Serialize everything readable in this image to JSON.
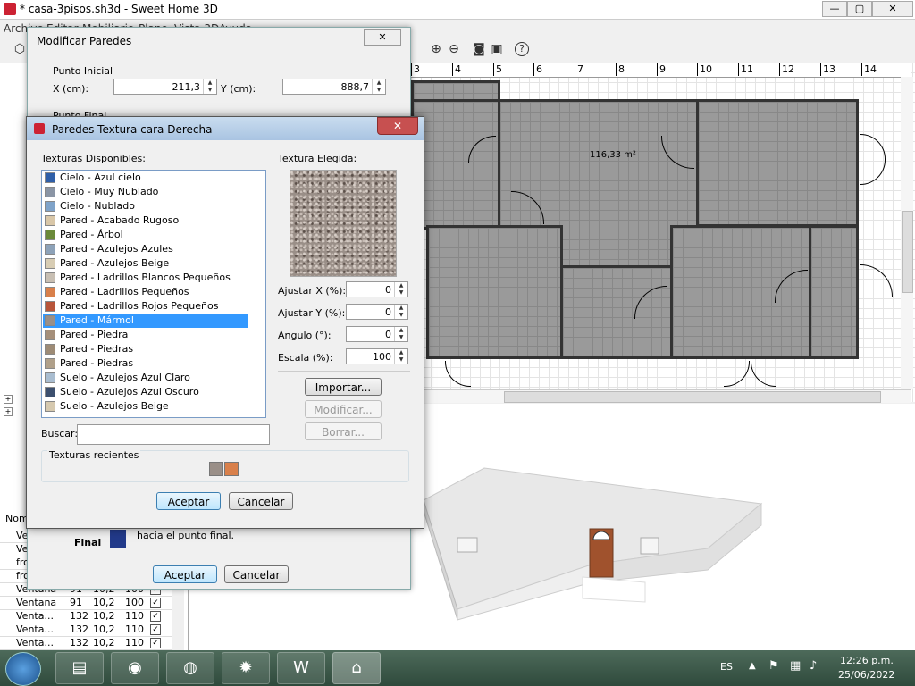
{
  "window": {
    "title": "* casa-3pisos.sh3d - Sweet Home 3D",
    "minimize": "—",
    "maximize": "▢",
    "close": "✕"
  },
  "menubar": [
    "Archivo",
    "Editar",
    "Mobiliario",
    "Plano",
    "Vista 3D",
    "Ayuda"
  ],
  "toolbar_icons": [
    "zoom-in-icon",
    "zoom-out-icon",
    "camera-icon",
    "video-icon",
    "help-icon"
  ],
  "plan": {
    "ruler": [
      "3",
      "4",
      "5",
      "6",
      "7",
      "8",
      "9",
      "10",
      "11",
      "12",
      "13",
      "14"
    ],
    "room_area": "116,33 m²"
  },
  "furniture_table": {
    "header": "Nom",
    "rows": [
      {
        "name": "Ven",
        "w": "",
        "d": "",
        "h": "",
        "visible": true
      },
      {
        "name": "Ven",
        "w": "",
        "d": "",
        "h": "",
        "visible": true
      },
      {
        "name": "fro",
        "w": "",
        "d": "",
        "h": "",
        "visible": true
      },
      {
        "name": "fro",
        "w": "",
        "d": "",
        "h": "",
        "visible": true
      },
      {
        "name": "Ventana",
        "w": "91",
        "d": "10,2",
        "h": "100",
        "visible": true
      },
      {
        "name": "Ventana",
        "w": "91",
        "d": "10,2",
        "h": "100",
        "visible": true
      },
      {
        "name": "Venta...",
        "w": "132",
        "d": "10,2",
        "h": "110",
        "visible": true
      },
      {
        "name": "Venta...",
        "w": "132",
        "d": "10,2",
        "h": "110",
        "visible": true
      },
      {
        "name": "Venta...",
        "w": "132",
        "d": "10,2",
        "h": "110",
        "visible": true
      }
    ]
  },
  "walls_dialog": {
    "title": "Modificar Paredes",
    "start_group": "Punto Inicial",
    "x_label": "X (cm):",
    "x_value": "211,3",
    "y_label": "Y (cm):",
    "y_value": "888,7",
    "end_group": "Punto Final",
    "final_label": "Final",
    "hint": "hacia el punto final.",
    "ok": "Aceptar",
    "cancel": "Cancelar"
  },
  "texture_dialog": {
    "title": "Paredes Textura cara Derecha",
    "available_label": "Texturas Disponibles:",
    "chosen_label": "Textura Elegida:",
    "textures": [
      {
        "name": "Cielo - Azul cielo",
        "color": "#2f5fa8"
      },
      {
        "name": "Cielo - Muy Nublado",
        "color": "#8a95a5"
      },
      {
        "name": "Cielo - Nublado",
        "color": "#7fa3c9"
      },
      {
        "name": "Pared - Acabado Rugoso",
        "color": "#d9c7a8"
      },
      {
        "name": "Pared - Árbol",
        "color": "#6b8a3a"
      },
      {
        "name": "Pared - Azulejos Azules",
        "color": "#8da2b8"
      },
      {
        "name": "Pared - Azulejos Beige",
        "color": "#d8cdb4"
      },
      {
        "name": "Pared - Ladrillos Blancos Pequeños",
        "color": "#c8bfb3"
      },
      {
        "name": "Pared - Ladrillos Pequeños",
        "color": "#d9804b"
      },
      {
        "name": "Pared - Ladrillos Rojos Pequeños",
        "color": "#b8553a"
      },
      {
        "name": "Pared - Mármol",
        "color": "#9a8f88"
      },
      {
        "name": "Pared - Piedra",
        "color": "#a58f7a"
      },
      {
        "name": "Pared - Piedras",
        "color": "#9d8b76"
      },
      {
        "name": "Pared - Piedras",
        "color": "#b0a08a"
      },
      {
        "name": "Suelo - Azulejos Azul Claro",
        "color": "#a9bdd0"
      },
      {
        "name": "Suelo - Azulejos Azul Oscuro",
        "color": "#3c4f6e"
      },
      {
        "name": "Suelo - Azulejos Beige",
        "color": "#d6c9af"
      }
    ],
    "selected": "Pared - Mármol",
    "adjust_x_label": "Ajustar X (%):",
    "adjust_x": "0",
    "adjust_y_label": "Ajustar Y (%):",
    "adjust_y": "0",
    "angle_label": "Ángulo (°):",
    "angle": "0",
    "scale_label": "Escala (%):",
    "scale": "100",
    "import": "Importar...",
    "modify": "Modificar...",
    "delete": "Borrar...",
    "search_label": "Buscar:",
    "search_value": "",
    "recent_label": "Texturas recientes",
    "ok": "Aceptar",
    "cancel": "Cancelar"
  },
  "taskbar": {
    "apps": [
      "explorer",
      "chrome",
      "firefox",
      "app-red",
      "word",
      "sweethome3d"
    ],
    "lang": "ES",
    "time": "12:26 p.m.",
    "date": "25/06/2022"
  }
}
